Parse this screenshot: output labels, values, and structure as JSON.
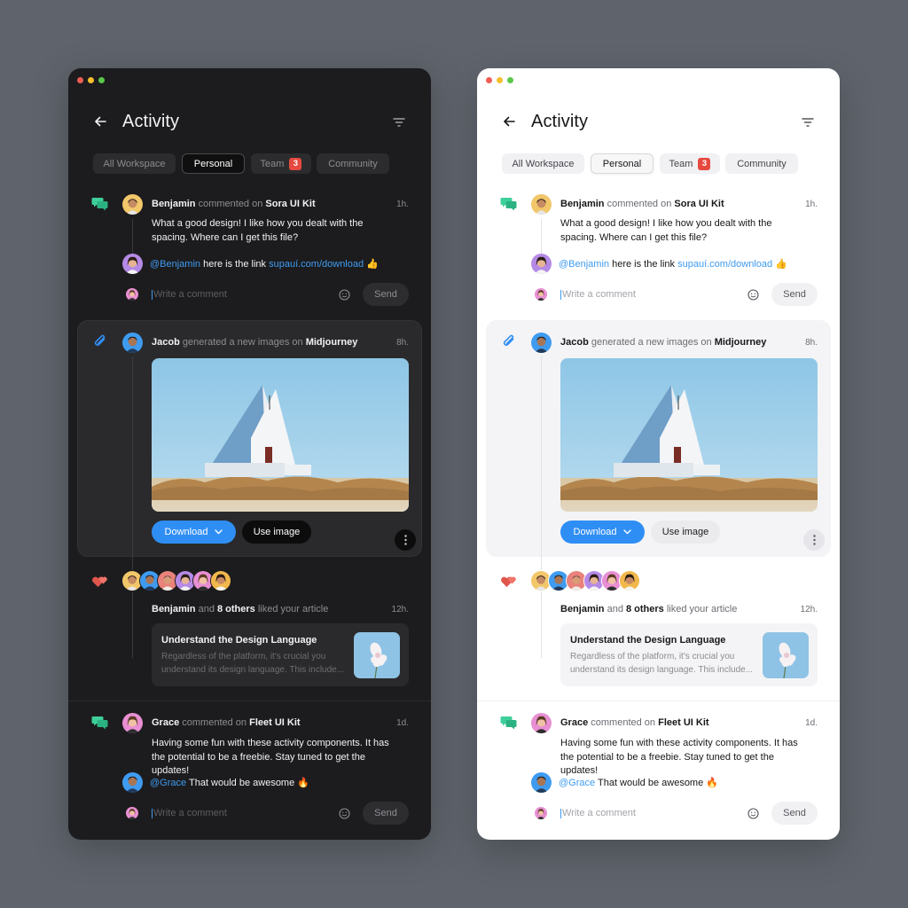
{
  "screen": {
    "title": "Activity",
    "icons": {
      "back": "arrow-left-icon",
      "filter": "filter-lines-icon"
    },
    "accent_color": "#2f8ef4",
    "badge_color": "#e5493f",
    "tabs": [
      {
        "label": "All Workspace",
        "active": false
      },
      {
        "label": "Personal",
        "active": true
      },
      {
        "label": "Team",
        "active": false,
        "badge": "3"
      },
      {
        "label": "Community",
        "active": false
      }
    ],
    "comment_box": {
      "placeholder": "Write a comment",
      "send_label": "Send",
      "emoji_icon": "smiley-icon"
    },
    "feed": {
      "benjamin_comment": {
        "icon": "chat-bubbles-icon",
        "user": "Benjamin",
        "action": "commented on",
        "target": "Sora UI Kit",
        "time": "1h.",
        "text": "What a good design! I like how you dealt with the spacing. Where can I get this file?",
        "reply": {
          "mention": "@Benjamin",
          "text": "here is the link",
          "link": "supauí.com/download",
          "emoji": "👍"
        }
      },
      "jacob_generation": {
        "icon": "paperclip-icon",
        "user": "Jacob",
        "action": "generated a new images on",
        "target": "Midjourney",
        "time": "8h.",
        "image_alt": "White A-frame house in a field under blue sky",
        "download_label": "Download",
        "use_image_label": "Use image",
        "more_icon": "more-vertical-icon"
      },
      "likes": {
        "icon": "hearts-icon",
        "user": "Benjamin",
        "mid": "and",
        "count": "8 others",
        "action": "liked your article",
        "time": "12h.",
        "article": {
          "title": "Understand the Design Language",
          "excerpt": "Regardless of the platform, it's crucial you understand its design language. This include..."
        }
      },
      "grace_comment": {
        "icon": "chat-bubbles-icon",
        "user": "Grace",
        "action": "commented on",
        "target": "Fleet UI Kit",
        "time": "1d.",
        "text": "Having some fun with these activity components. It has the potential to be a freebie.  Stay tuned to get the updates!",
        "reply": {
          "mention": "@Grace",
          "text": "That would be awesome",
          "emoji": "🔥"
        }
      }
    }
  }
}
